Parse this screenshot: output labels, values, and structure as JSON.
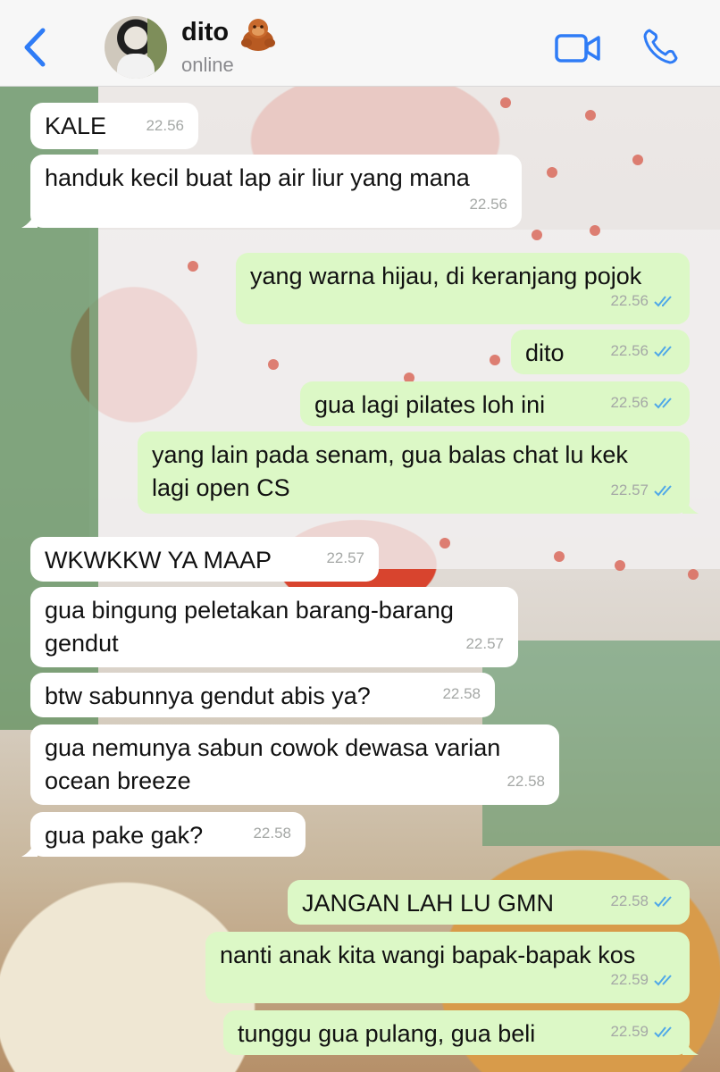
{
  "header": {
    "back_icon": "chevron-left-icon",
    "contact_name": "dito",
    "contact_emoji": "orangutan-emoji",
    "status": "online",
    "video_icon": "video-camera-icon",
    "call_icon": "phone-icon",
    "accent_color": "#2f7cf6"
  },
  "colors": {
    "incoming_bubble": "#ffffff",
    "outgoing_bubble": "#dcf8c6",
    "read_ticks": "#4fa8e8",
    "timestamp": "#a5a8a6"
  },
  "messages": [
    {
      "direction": "in",
      "text": "KALE",
      "time": "22.56"
    },
    {
      "direction": "in",
      "text": "handuk kecil buat lap air liur yang mana",
      "time": "22.56"
    },
    {
      "direction": "out",
      "text": "yang warna hijau, di keranjang pojok",
      "time": "22.56",
      "status": "read"
    },
    {
      "direction": "out",
      "text": "dito",
      "time": "22.56",
      "status": "read"
    },
    {
      "direction": "out",
      "text": "gua lagi pilates loh ini",
      "time": "22.56",
      "status": "read"
    },
    {
      "direction": "out",
      "text": "yang lain pada senam, gua balas chat lu kek\nlagi open CS",
      "time": "22.57",
      "status": "read"
    },
    {
      "direction": "in",
      "text": "WKWKKW YA MAAP",
      "time": "22.57"
    },
    {
      "direction": "in",
      "text": "gua bingung peletakan barang-barang\ngendut",
      "time": "22.57"
    },
    {
      "direction": "in",
      "text": "btw sabunnya gendut abis ya?",
      "time": "22.58"
    },
    {
      "direction": "in",
      "text": "gua nemunya sabun cowok dewasa varian\nocean breeze",
      "time": "22.58"
    },
    {
      "direction": "in",
      "text": "gua pake gak?",
      "time": "22.58"
    },
    {
      "direction": "out",
      "text": "JANGAN LAH LU GMN",
      "time": "22.58",
      "status": "read"
    },
    {
      "direction": "out",
      "text": "nanti anak kita wangi bapak-bapak kos",
      "time": "22.59",
      "status": "read"
    },
    {
      "direction": "out",
      "text": "tunggu gua pulang, gua beli",
      "time": "22.59",
      "status": "read"
    }
  ]
}
